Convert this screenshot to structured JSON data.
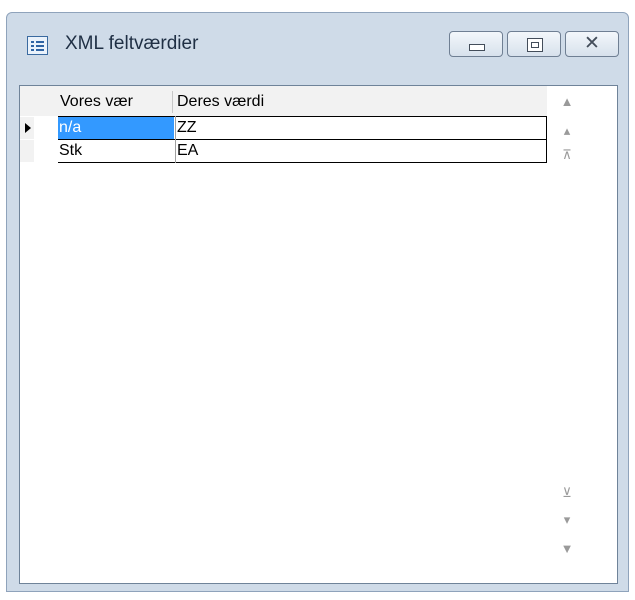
{
  "window": {
    "title": "XML feltværdier",
    "icon": "form-icon",
    "controls": {
      "minimize": "minimize-icon",
      "maximize": "maximize-icon",
      "close": "close-icon",
      "close_glyph": "✕"
    }
  },
  "table": {
    "columns": [
      "Vores vær",
      "Deres værdi"
    ],
    "rows": [
      {
        "ours": "n/a",
        "theirs": "ZZ",
        "current": true
      },
      {
        "ours": "Stk",
        "theirs": "EA",
        "current": false
      }
    ],
    "current_row_indicator": "current-row-arrow-icon"
  },
  "navigation": {
    "buttons": [
      {
        "icon": "scroll-page-up-icon",
        "glyph": "▲"
      },
      {
        "icon": "previous-record-icon",
        "glyph": "▴"
      },
      {
        "icon": "first-record-icon",
        "glyph": "⊼"
      },
      {
        "icon": "last-record-icon",
        "glyph": "⊻"
      },
      {
        "icon": "next-record-icon",
        "glyph": "▾"
      },
      {
        "icon": "scroll-page-down-icon",
        "glyph": "▼"
      }
    ]
  },
  "colors": {
    "selection": "#3399ff",
    "selection_text": "#ffffff"
  }
}
